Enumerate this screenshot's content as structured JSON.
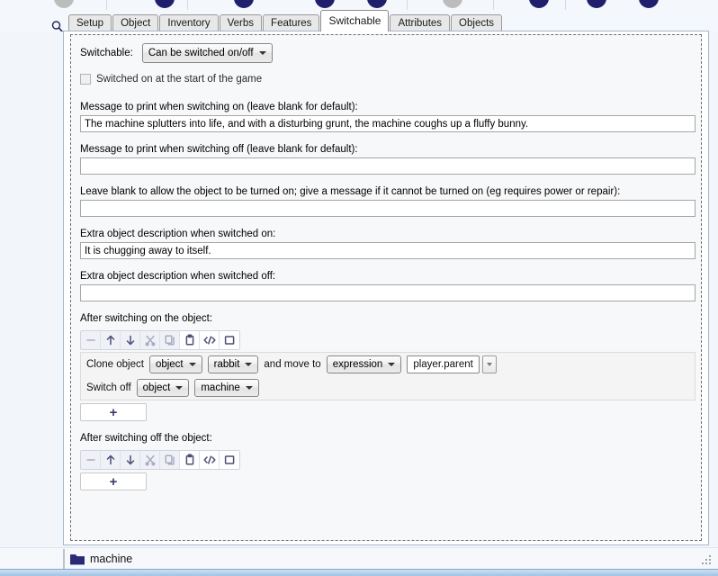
{
  "toolbar": {
    "buttons": [
      {
        "name": "toolbar-button-1",
        "color": "#bcbcbc"
      },
      {
        "name": "toolbar-button-2",
        "color": "#1f1f6e"
      },
      {
        "name": "toolbar-button-3",
        "color": "#1f1f6e"
      },
      {
        "name": "toolbar-button-4",
        "color": "#1f1f6e"
      },
      {
        "name": "toolbar-button-5",
        "color": "#1f1f6e"
      },
      {
        "name": "toolbar-button-6",
        "color": "#bcbcbc"
      },
      {
        "name": "toolbar-button-7",
        "color": "#1f1f6e"
      },
      {
        "name": "toolbar-button-8",
        "color": "#1f1f6e"
      },
      {
        "name": "toolbar-button-9",
        "color": "#1f1f6e"
      }
    ],
    "search_icon": "search-icon"
  },
  "tabs": [
    {
      "label": "Setup",
      "active": false
    },
    {
      "label": "Object",
      "active": false
    },
    {
      "label": "Inventory",
      "active": false
    },
    {
      "label": "Verbs",
      "active": false
    },
    {
      "label": "Features",
      "active": false
    },
    {
      "label": "Switchable",
      "active": true
    },
    {
      "label": "Attributes",
      "active": false
    },
    {
      "label": "Objects",
      "active": false
    }
  ],
  "form": {
    "switchable_label": "Switchable:",
    "switchable_value": "Can be switched on/off",
    "switchable_options": [
      "Can be switched on/off"
    ],
    "start_on_checkbox_label": "Switched on at the start of the game",
    "start_on_checked": false,
    "msg_on_label": "Message to print when switching on (leave blank for default):",
    "msg_on_value": "The machine splutters into life, and with a disturbing grunt, the machine coughs up a fluffy bunny.",
    "msg_off_label": "Message to print when switching off (leave blank for default):",
    "msg_off_value": "",
    "cannot_turn_on_label": "Leave blank to allow the object to be turned on; give a message if it cannot be turned on (eg requires power or repair):",
    "cannot_turn_on_value": "",
    "desc_on_label": "Extra object description when switched on:",
    "desc_on_value": "It is chugging away to itself.",
    "desc_off_label": "Extra object description when switched off:",
    "desc_off_value": "",
    "after_on_label": "After switching on the object:",
    "after_off_label": "After switching off the object:",
    "add_button_label": "+"
  },
  "script_toolbar": {
    "icons": [
      {
        "name": "remove-icon",
        "glyph": "minus"
      },
      {
        "name": "move-up-icon",
        "glyph": "arrow-up"
      },
      {
        "name": "move-down-icon",
        "glyph": "arrow-down"
      },
      {
        "name": "cut-icon",
        "glyph": "scissors"
      },
      {
        "name": "copy-icon",
        "glyph": "copy"
      },
      {
        "name": "paste-icon",
        "glyph": "clipboard"
      },
      {
        "name": "code-view-icon",
        "glyph": "code"
      },
      {
        "name": "stop-icon",
        "glyph": "square"
      }
    ]
  },
  "script_on": {
    "rows": [
      {
        "name": "script-row-clone-object",
        "parts": [
          {
            "type": "text",
            "value": "Clone object"
          },
          {
            "type": "select",
            "name": "clone-type-select",
            "value": "object"
          },
          {
            "type": "select",
            "name": "clone-target-select",
            "value": "rabbit"
          },
          {
            "type": "text",
            "value": "and move to"
          },
          {
            "type": "select",
            "name": "move-to-type-select",
            "value": "expression"
          },
          {
            "type": "expr",
            "name": "move-to-expression-input",
            "value": "player.parent"
          }
        ]
      },
      {
        "name": "script-row-switch-off",
        "parts": [
          {
            "type": "text",
            "value": "Switch off"
          },
          {
            "type": "select",
            "name": "switch-off-type-select",
            "value": "object"
          },
          {
            "type": "select",
            "name": "switch-off-target-select",
            "value": "machine"
          }
        ]
      }
    ]
  },
  "script_off": {
    "rows": []
  },
  "statusbar": {
    "icon": "folder-icon",
    "label": "machine"
  },
  "colors": {
    "accent": "#1f1f6e",
    "tab_active_bg": "#ffffff",
    "panel_bg": "#f7f8f9",
    "script_bg": "#f4f4f4"
  }
}
